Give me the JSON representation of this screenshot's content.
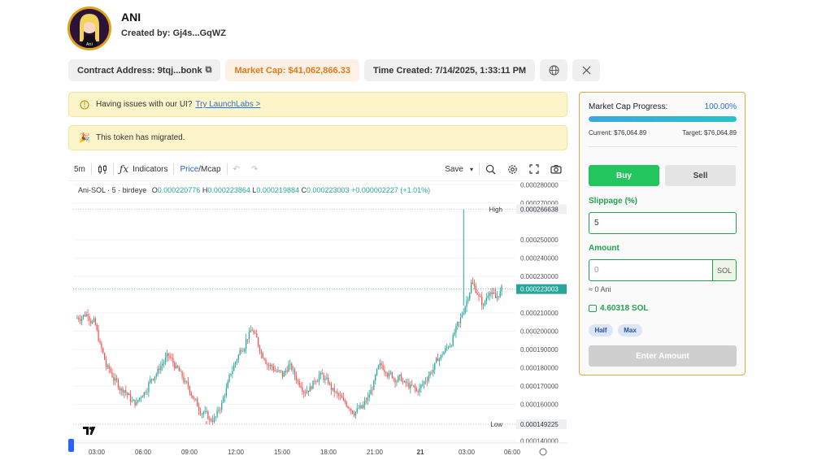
{
  "token": {
    "name": "ANI",
    "created_by": "Created by: Gj4s...GqWZ",
    "avatar_caption": "Ani"
  },
  "info": {
    "contract": "Contract Address: 9tqj...bonk",
    "market_cap": "Market Cap: $41,062,866.33",
    "time_created": "Time Created: 7/14/2025, 1:33:11 PM"
  },
  "banners": {
    "issue_text": "Having issues with our UI?",
    "issue_link": "Try LaunchLabs >",
    "migrated_text": "This token has migrated."
  },
  "toolbar": {
    "interval": "5m",
    "indicators": "Indicators",
    "price_label": "Price",
    "mcap_label": "/Mcap",
    "save": "Save"
  },
  "chart_legend": {
    "symbol": "Ani-SOL · 5 · birdeye",
    "o_label": "O",
    "o": "0.000220776",
    "h_label": "H",
    "h": "0.000223864",
    "l_label": "L",
    "l": "0.000219884",
    "c_label": "C",
    "c": "0.000223003",
    "change": "+0.000002227 (+1.01%)"
  },
  "chart_data": {
    "type": "candlestick",
    "x_tick_labels": [
      "03:00",
      "06:00",
      "09:00",
      "12:00",
      "15:00",
      "18:00",
      "21:00",
      "21",
      "03:00",
      "06:00"
    ],
    "y_tick_labels": [
      "0.000280000",
      "0.000270000",
      "0.000250000",
      "0.000240000",
      "0.000230000",
      "0.000210000",
      "0.000200000",
      "0.000190000",
      "0.000180000",
      "0.000170000",
      "0.000160000",
      "0.000140000"
    ],
    "y_ticks": [
      0.00028,
      0.00027,
      0.00025,
      0.00024,
      0.00023,
      0.00021,
      0.0002,
      0.00019,
      0.00018,
      0.00017,
      0.00016,
      0.00014
    ],
    "ylim": [
      0.000139,
      0.000281
    ],
    "high_label": "High",
    "high": 0.000266638,
    "high_text": "0.000266638",
    "low_label": "Low",
    "low": 0.000149225,
    "low_text": "0.000149225",
    "last_price": 0.000223003,
    "last_price_text": "0.000223003",
    "up_color": "#26a69a",
    "down_color": "#ef5350",
    "closes": [
      0.000208,
      0.00021,
      0.000205,
      0.000192,
      0.000181,
      0.000176,
      0.000171,
      0.000168,
      0.000163,
      0.00016,
      0.000166,
      0.000171,
      0.000176,
      0.000181,
      0.000186,
      0.000183,
      0.000178,
      0.000171,
      0.000166,
      0.00016,
      0.000156,
      0.000151,
      0.000153,
      0.00016,
      0.000171,
      0.000181,
      0.000189,
      0.000195,
      0.000201,
      0.000193,
      0.000186,
      0.000181,
      0.000178,
      0.000176,
      0.000181,
      0.000176,
      0.000171,
      0.000168,
      0.000171,
      0.000176,
      0.000173,
      0.000169,
      0.000165,
      0.000161,
      0.000159,
      0.000156,
      0.000158,
      0.000163,
      0.000171,
      0.000181,
      0.000179,
      0.000176,
      0.000174,
      0.000171,
      0.000169,
      0.000167,
      0.000171,
      0.000176,
      0.000181,
      0.000186,
      0.000191,
      0.000196,
      0.000204,
      0.000214,
      0.000226,
      0.000221,
      0.000213,
      0.000223,
      0.000218,
      0.000223
    ]
  },
  "panel": {
    "progress_label": "Market Cap Progress:",
    "progress_pct_text": "100.00%",
    "progress": 1.0,
    "current": "Current: $76,064.89",
    "target": "Target: $76,064.89",
    "buy": "Buy",
    "sell": "Sell",
    "slippage_label": "Slippage (%)",
    "slippage_value": "5",
    "amount_label": "Amount",
    "amount_placeholder": "0",
    "amount_unit": "SOL",
    "approx": "≈ 0 Ani",
    "balance": "4.60318 SOL",
    "half": "Half",
    "max": "Max",
    "enter_amount": "Enter Amount"
  }
}
